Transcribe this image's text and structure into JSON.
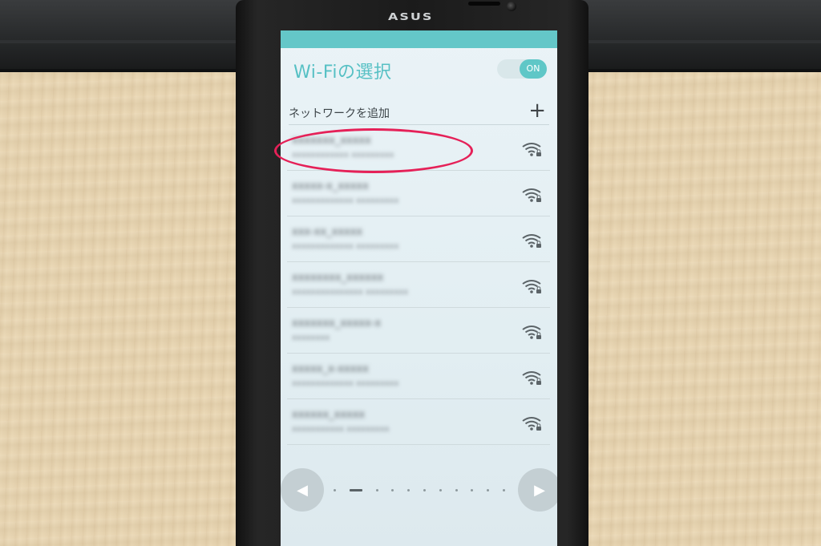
{
  "device": {
    "brand_logo": "ASUS"
  },
  "screen": {
    "title": "Wi-Fiの選択",
    "toggle": {
      "label": "ON",
      "state": "on"
    },
    "add_network": {
      "label": "ネットワークを追加",
      "icon": "plus-icon"
    },
    "networks": [
      {
        "ssid": "xxxxxxx_xxxxx",
        "detail": "xxxxxxxxxxxx  xxxxxxxxx",
        "icon": "wifi-lock-icon",
        "highlighted": true
      },
      {
        "ssid": "xxxxx-x_xxxxx",
        "detail": "xxxxxxxxxxxxx    xxxxxxxxx",
        "icon": "wifi-lock-icon",
        "highlighted": false
      },
      {
        "ssid": "xxx-xx_xxxxx",
        "detail": "xxxxxxxxxxxxx    xxxxxxxxx",
        "icon": "wifi-lock-icon",
        "highlighted": false
      },
      {
        "ssid": "xxxxxxxx_xxxxxx",
        "detail": "xxxxxxxxxxxxxxx    xxxxxxxxx",
        "icon": "wifi-lock-icon",
        "highlighted": false
      },
      {
        "ssid": "xxxxxxx_xxxxx-x",
        "detail": "xxxxxxxx",
        "icon": "wifi-lock-icon",
        "highlighted": false
      },
      {
        "ssid": "xxxxx_x-xxxxx",
        "detail": "xxxxxxxxxxxxx    xxxxxxxxx",
        "icon": "wifi-lock-icon",
        "highlighted": false
      },
      {
        "ssid": "xxxxxx_xxxxx",
        "detail": "xxxxxxxxxxx    xxxxxxxxx",
        "icon": "wifi-lock-icon",
        "highlighted": false
      }
    ],
    "nav": {
      "prev_icon": "◀",
      "next_icon": "▶",
      "page_count": 11,
      "current_page": 2
    }
  },
  "colors": {
    "accent": "#5fc7c7",
    "highlight": "#e52158"
  }
}
